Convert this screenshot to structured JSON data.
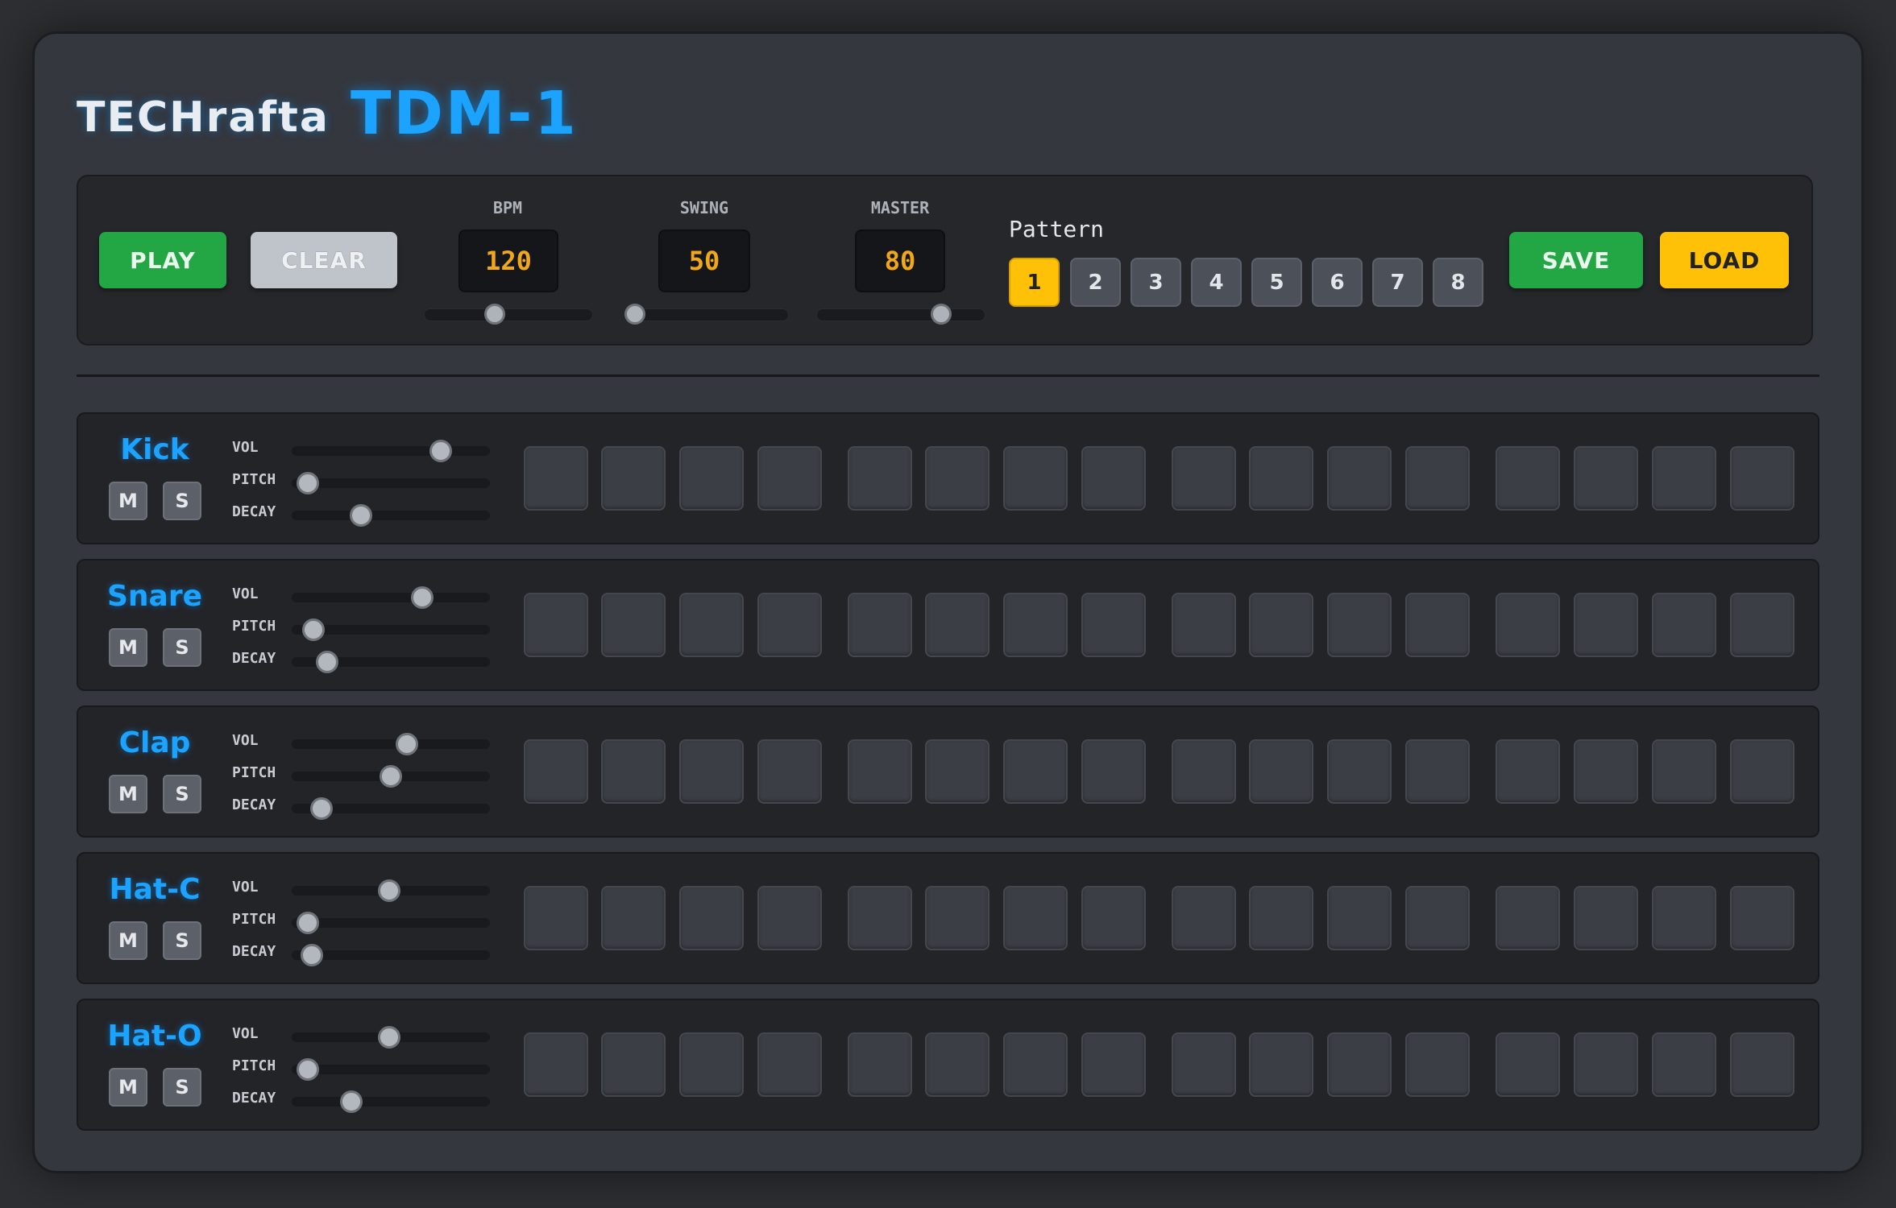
{
  "brand": {
    "maker": "TECHrafta",
    "model": "TDM-1"
  },
  "transport": {
    "play": "PLAY",
    "clear": "CLEAR",
    "save": "SAVE",
    "load": "LOAD"
  },
  "controls": {
    "bpm": {
      "label": "BPM",
      "value": "120",
      "slider": 0.42
    },
    "swing": {
      "label": "SWING",
      "value": "50",
      "slider": 0.0
    },
    "master": {
      "label": "MASTER",
      "value": "80",
      "slider": 0.74
    }
  },
  "pattern": {
    "label": "Pattern",
    "buttons": [
      "1",
      "2",
      "3",
      "4",
      "5",
      "6",
      "7",
      "8"
    ],
    "active": 0
  },
  "params": {
    "vol": "VOL",
    "pitch": "PITCH",
    "decay": "DECAY"
  },
  "mute_label": "M",
  "solo_label": "S",
  "tracks": [
    {
      "name": "Kick",
      "vol": 0.75,
      "pitch": 0.08,
      "decay": 0.35
    },
    {
      "name": "Snare",
      "vol": 0.66,
      "pitch": 0.11,
      "decay": 0.18
    },
    {
      "name": "Clap",
      "vol": 0.58,
      "pitch": 0.5,
      "decay": 0.15
    },
    {
      "name": "Hat-C",
      "vol": 0.49,
      "pitch": 0.08,
      "decay": 0.1
    },
    {
      "name": "Hat-O",
      "vol": 0.49,
      "pitch": 0.08,
      "decay": 0.3
    }
  ],
  "steps_per_track": 16,
  "colors": {
    "accent": "#1ba3ff",
    "play": "#23a744",
    "load": "#ffc107",
    "display": "#f0a81a"
  }
}
